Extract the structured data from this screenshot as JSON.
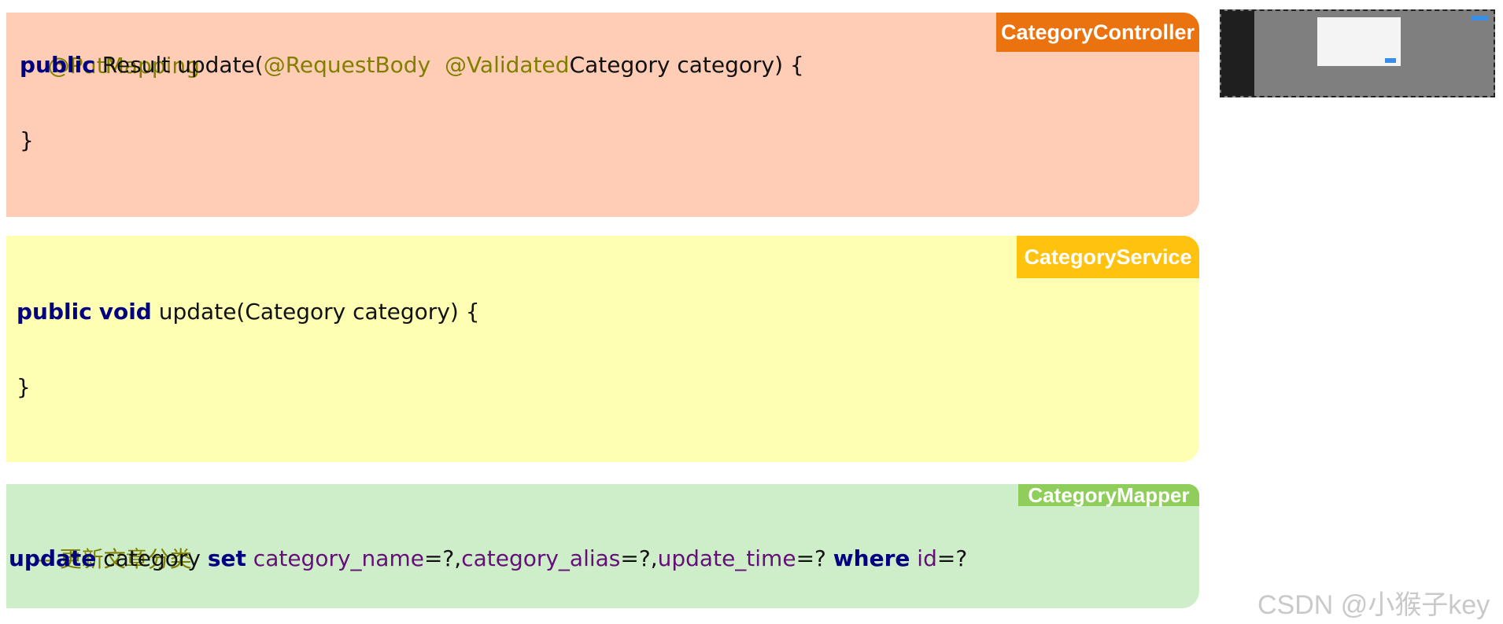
{
  "controller": {
    "tag": "CategoryController",
    "line1": "@PutMapping",
    "line2": {
      "kw": "public",
      "t1": " Result update(",
      "a1": "@RequestBody",
      "sp": "  ",
      "a2": "@Validated",
      "t2": "Category category) {"
    },
    "close": "}"
  },
  "service": {
    "tag": "CategoryService",
    "line1": {
      "kw1": "public",
      "sp": " ",
      "kw2": "void",
      "t1": " update(Category category) {"
    },
    "close": "}"
  },
  "mapper": {
    "tag": "CategoryMapper",
    "comment": "-- 更新文章分类",
    "sql": {
      "k1": "update",
      "t1": " category ",
      "k2": "set",
      "sp1": " ",
      "c1": "category_name",
      "t2": "=?,",
      "c2": "category_alias",
      "t3": "=?,",
      "c3": "update_time",
      "t4": "=? ",
      "k3": "where",
      "sp2": " ",
      "c4": "id",
      "t5": "=?"
    }
  },
  "watermark": "CSDN @小猴子key",
  "thumbnail": {
    "icon": "ui-screenshot-thumbnail"
  }
}
